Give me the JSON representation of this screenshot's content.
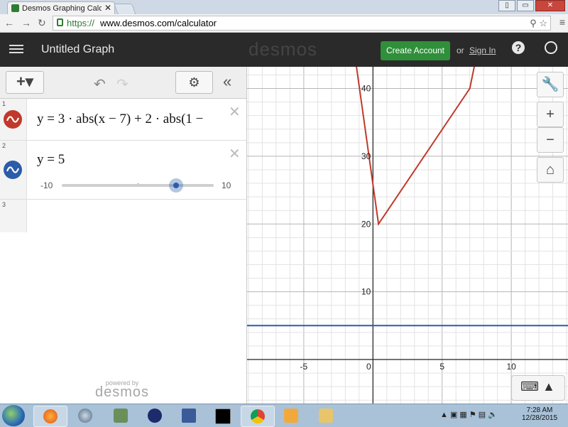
{
  "browser": {
    "tab_title": "Desmos Graphing Calculat",
    "tab_close": "✕",
    "url_scheme": "https://",
    "url_host": "www.desmos.com/calculator",
    "window_controls": [
      "▯",
      "▭",
      "✕"
    ]
  },
  "header": {
    "graph_title": "Untitled Graph",
    "logo": "desmos",
    "create_account": "Create Account",
    "or": "or",
    "sign_in": "Sign In",
    "help": "?"
  },
  "panel": {
    "add": "+▾",
    "collapse": "«",
    "expressions": [
      {
        "num": "1",
        "latex": "y = 3 · abs(x − 7) + 2 · abs(1 −",
        "color": "#c0392b"
      },
      {
        "num": "2",
        "latex": "y = 5",
        "color": "#2b5caa",
        "slider": {
          "min_label": "-10",
          "max_label": "10",
          "min": -10,
          "max": 10,
          "value": 5
        }
      },
      {
        "num": "3",
        "latex": ""
      }
    ],
    "powered_small": "powered by",
    "powered_logo": "desmos"
  },
  "graph": {
    "x_ticks": [
      "-5",
      "0",
      "5",
      "10"
    ],
    "y_ticks": [
      "10",
      "20",
      "30",
      "40"
    ],
    "xlim": [
      -9.1,
      14.1
    ],
    "ylim": [
      -6.5,
      43.2
    ],
    "series": [
      {
        "color": "#c0392b",
        "points": [
          [
            -2,
            55
          ],
          [
            0.4,
            20
          ],
          [
            7,
            40
          ],
          [
            9,
            60
          ]
        ]
      },
      {
        "color": "#2b5caa",
        "points": [
          [
            -9.1,
            5
          ],
          [
            14.1,
            5
          ]
        ]
      }
    ],
    "tools": [
      "🔧",
      "+",
      "−",
      "⌂"
    ],
    "keyboard": "⌨ ▲"
  },
  "taskbar": {
    "time": "7:28 AM",
    "date": "12/28/2015"
  }
}
